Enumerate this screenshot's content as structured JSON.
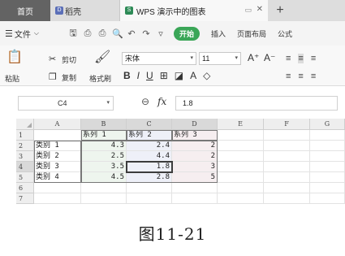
{
  "tabs": {
    "home": "首页",
    "doc": "稻壳",
    "doc_icon": "D",
    "active": "WPS 演示中的图表",
    "active_icon": "S",
    "new_tab": "+"
  },
  "menu": {
    "file": "文件",
    "start": "开始",
    "insert": "插入",
    "page_layout": "页面布局",
    "formula": "公式"
  },
  "ribbon": {
    "paste": "粘贴",
    "cut": "剪切",
    "copy": "复制",
    "format_painter": "格式刷",
    "font_name": "宋体",
    "font_size": "11"
  },
  "formula_bar": {
    "name_box": "C4",
    "fx": "fx",
    "value": "1.8"
  },
  "grid": {
    "columns": [
      "A",
      "B",
      "C",
      "D",
      "E",
      "F",
      "G"
    ],
    "rows": [
      "1",
      "2",
      "3",
      "4",
      "5",
      "6",
      "7"
    ],
    "header": [
      "",
      "系列 1",
      "系列 2",
      "系列 3"
    ],
    "data": [
      [
        "类别 1",
        "4.3",
        "2.4",
        "2"
      ],
      [
        "类别 2",
        "2.5",
        "4.4",
        "2"
      ],
      [
        "类别 3",
        "3.5",
        "1.8",
        "3"
      ],
      [
        "类别 4",
        "4.5",
        "2.8",
        "5"
      ]
    ],
    "active_cell": "C4"
  },
  "caption": "图11-21"
}
